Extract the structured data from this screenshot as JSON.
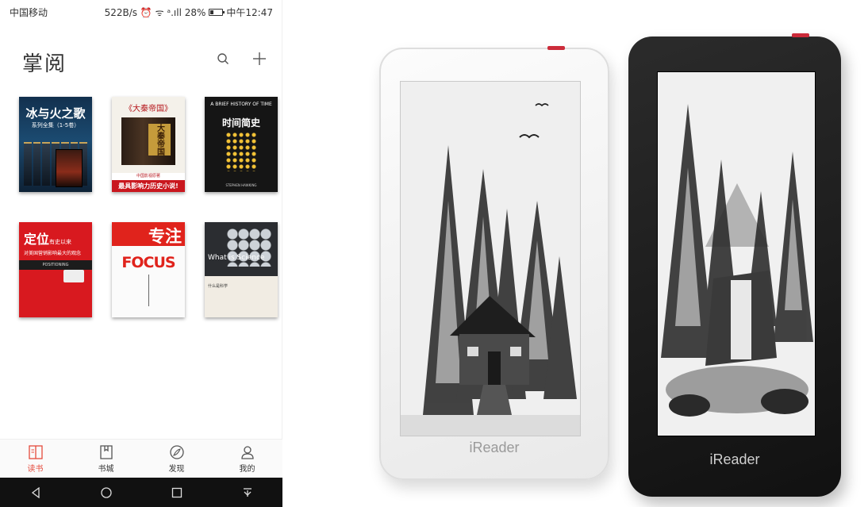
{
  "status_bar": {
    "carrier": "中国移动",
    "right": "522B/s ⏰ ᯤ ᵃ.ıll 28%",
    "time": "中午12:47"
  },
  "app": {
    "title": "掌阅"
  },
  "books": [
    {
      "title": "冰与火之歌",
      "subtitle": "系列全集（1-5卷）"
    },
    {
      "title": "《大秦帝国》",
      "spine": "大秦帝国",
      "band_small": "中国影视原著",
      "band": "最具影响力历史小说!"
    },
    {
      "title": "A BRIEF HISTORY OF TIME",
      "subtitle": "时间简史",
      "author": "STEPHEN HAWKING"
    },
    {
      "title": "定位",
      "tagline": "有史以来",
      "subtitle": "对美国营销影响最大的观念",
      "band": "POSITIONING"
    },
    {
      "title": "专注",
      "subtitle": "FOCUS"
    },
    {
      "title": "What is Science",
      "subtitle": "什么是科学"
    }
  ],
  "tabs": [
    {
      "label": "读书",
      "icon": "book-icon",
      "active": true
    },
    {
      "label": "书城",
      "icon": "store-icon",
      "active": false
    },
    {
      "label": "发现",
      "icon": "compass-icon",
      "active": false
    },
    {
      "label": "我的",
      "icon": "profile-icon",
      "active": false
    }
  ],
  "devices": [
    {
      "brand": "iReader",
      "color": "white"
    },
    {
      "brand": "iReader",
      "color": "black"
    }
  ],
  "colors": {
    "accent": "#e54a3c",
    "power_button": "#cc2b3a"
  }
}
